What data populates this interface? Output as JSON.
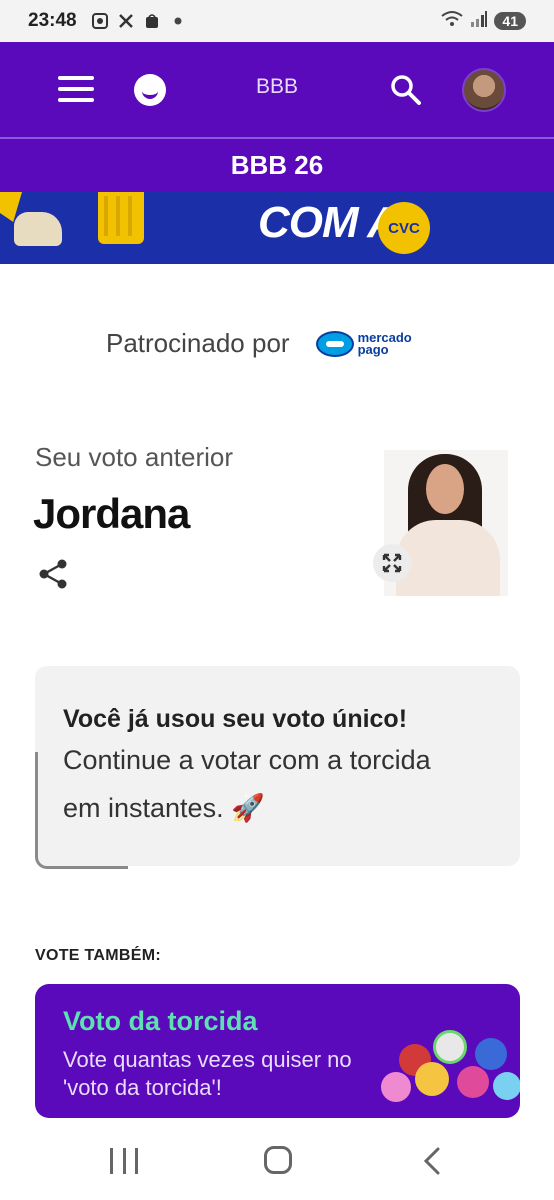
{
  "status_bar": {
    "time": "23:48",
    "icons": [
      "screenshot-icon",
      "x-icon",
      "shopping-icon",
      "dot-icon"
    ],
    "battery": "41"
  },
  "header": {
    "title": "BBB",
    "menu_icon": "hamburger-icon",
    "search_icon": "search-icon"
  },
  "sub_header": {
    "title": "BBB 26"
  },
  "banner": {
    "text": "COM A",
    "badge": "CVC"
  },
  "sponsor": {
    "label": "Patrocinado por",
    "brand_line1": "mercado",
    "brand_line2": "pago"
  },
  "previous_vote": {
    "label": "Seu voto anterior",
    "name": "Jordana"
  },
  "info_card": {
    "bold": "Você já usou seu voto único!",
    "line1": "Continue a votar com a torcida",
    "line2": "em instantes. 🚀"
  },
  "vote_also": {
    "label": "VOTE TAMBÉM:",
    "card_title": "Voto da torcida",
    "card_desc": "Vote quantas vezes quiser no 'voto da torcida'!"
  },
  "colors": {
    "primary_purple": "#5a0aba",
    "accent_green": "#5fe0b0",
    "banner_blue": "#1a2fa8",
    "cvc_yellow": "#f2c200"
  }
}
